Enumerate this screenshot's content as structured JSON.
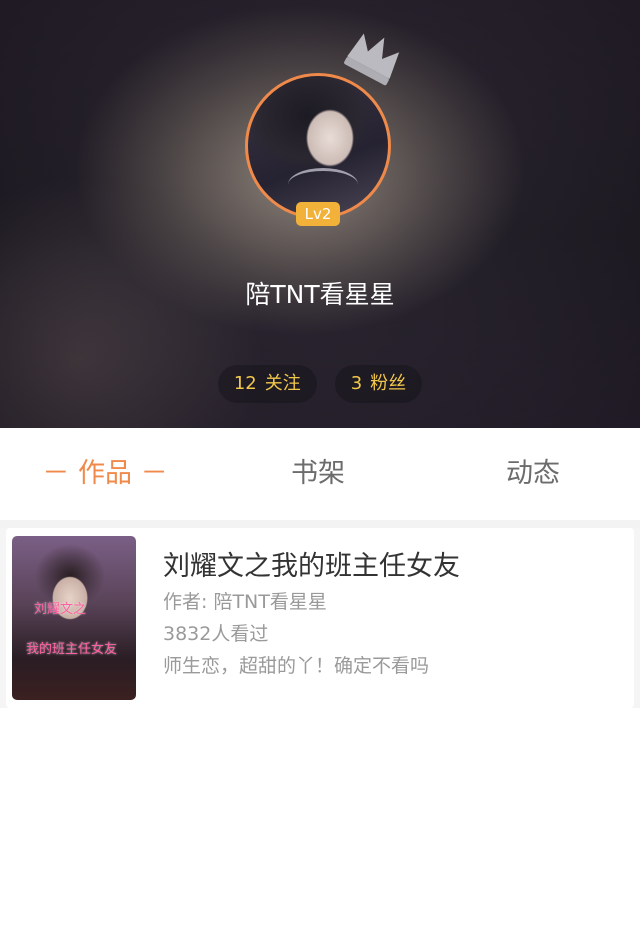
{
  "profile": {
    "username": "陪TNT看星星",
    "level": "Lv2",
    "following_count": "12",
    "following_label": "关注",
    "fans_count": "3",
    "fans_label": "粉丝"
  },
  "tabs": [
    {
      "label": "－ 作品 －",
      "active": true
    },
    {
      "label": "书架",
      "active": false
    },
    {
      "label": "动态",
      "active": false
    }
  ],
  "works": [
    {
      "title": "刘耀文之我的班主任女友",
      "author": "作者: 陪TNT看星星",
      "views": "3832人看过",
      "summary": "师生恋，超甜的丫！确定不看吗",
      "cover_text": [
        "刘耀文之",
        "我的班主任女友"
      ]
    }
  ],
  "colors": {
    "accent": "#f08a4b",
    "level_badge": "#f2b239",
    "stat_text": "#f2c84b"
  },
  "icons": {
    "crown": "crown-icon"
  }
}
